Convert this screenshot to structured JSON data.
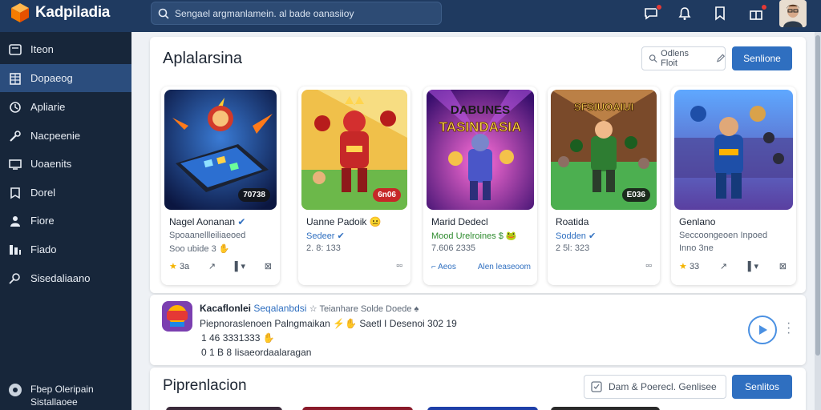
{
  "app": {
    "name": "Kadpiladia"
  },
  "search": {
    "placeholder": "Sengael argmanlamein. al bade oanasiioy"
  },
  "sidebar": {
    "items": [
      {
        "label": "Iteon",
        "icon": "window-icon",
        "active": false
      },
      {
        "label": "Dopaeog",
        "icon": "building-icon",
        "active": true
      },
      {
        "label": "Apliarie",
        "icon": "clock-icon",
        "active": false
      },
      {
        "label": "Nacpeenie",
        "icon": "wrench-icon",
        "active": false
      },
      {
        "label": "Uoaenits",
        "icon": "monitor-icon",
        "active": false
      },
      {
        "label": "Dorel",
        "icon": "bookmark-icon",
        "active": false
      },
      {
        "label": "Fiore",
        "icon": "person-icon",
        "active": false
      },
      {
        "label": "Fiado",
        "icon": "columns-icon",
        "active": false
      },
      {
        "label": "Sisedaliaano",
        "icon": "search-icon",
        "active": false
      }
    ],
    "footer": {
      "line1": "Fbep Oleripain",
      "line2": "Sistallaoee"
    }
  },
  "main": {
    "title": "Aplalarsina",
    "filter_label": "Odlens Floit",
    "primary_label": "Senlione",
    "cards": [
      {
        "name": "Nagel Aonanan",
        "sub": "Spoaanellleiliaeoed",
        "sub_color": "#5d6877",
        "meta": "Soo ubide 3 ✋",
        "badge": "70738",
        "rating": "3a",
        "thumb": "tablet"
      },
      {
        "name": "Uanne Padoik 😐",
        "sub": "Sedeer",
        "sub_color": "#2f6fc0",
        "meta": "2. 8: 133",
        "badge": "6n06",
        "thumb": "hero-red"
      },
      {
        "name": "Marid Dedecl",
        "sub": "Mood Urelroines $ 🐸",
        "sub_color": "#2e8b2e",
        "meta": "7.606 2335",
        "title_art": "DABUNES TASINDASIA",
        "link1": "Aeos",
        "link2": "Alen leaseoom",
        "thumb": "hero-purple"
      },
      {
        "name": "Roatida",
        "sub": "Sodden",
        "sub_color": "#2f6fc0",
        "meta": "2 5l: 323",
        "badge": "E036",
        "title_art": "SFSIUOAIUI",
        "thumb": "hero-green"
      },
      {
        "name": "Genlano",
        "sub": "Seccoongeoen Inpoed",
        "sub_color": "#5d6877",
        "meta": "Inno 3ne",
        "rating": "33",
        "thumb": "hero-blue"
      }
    ]
  },
  "feed": {
    "title": "Kacaflonlei",
    "title_link": "Seqalanbdsi",
    "title_tail": "☆ Teianhare Solde Doede ♠",
    "line2": "Piepnoraslenoen Palngmaikan ⚡✋ Saetl",
    "line2_tail": "I Desenoi 302 19",
    "line3": "1 46 3331333 ✋",
    "line4": "0 1 B  8 Iisaeordaalaragan"
  },
  "section2": {
    "title": "Piprenlacion",
    "check_label": "Dam & Poerecl. Genlisee",
    "primary_label": "Senlitos"
  },
  "colors": {
    "accent": "#2f6fc0",
    "topbar": "#1f3a60",
    "sidebar": "#17263a",
    "sidebar_active": "#2b4d7d"
  }
}
